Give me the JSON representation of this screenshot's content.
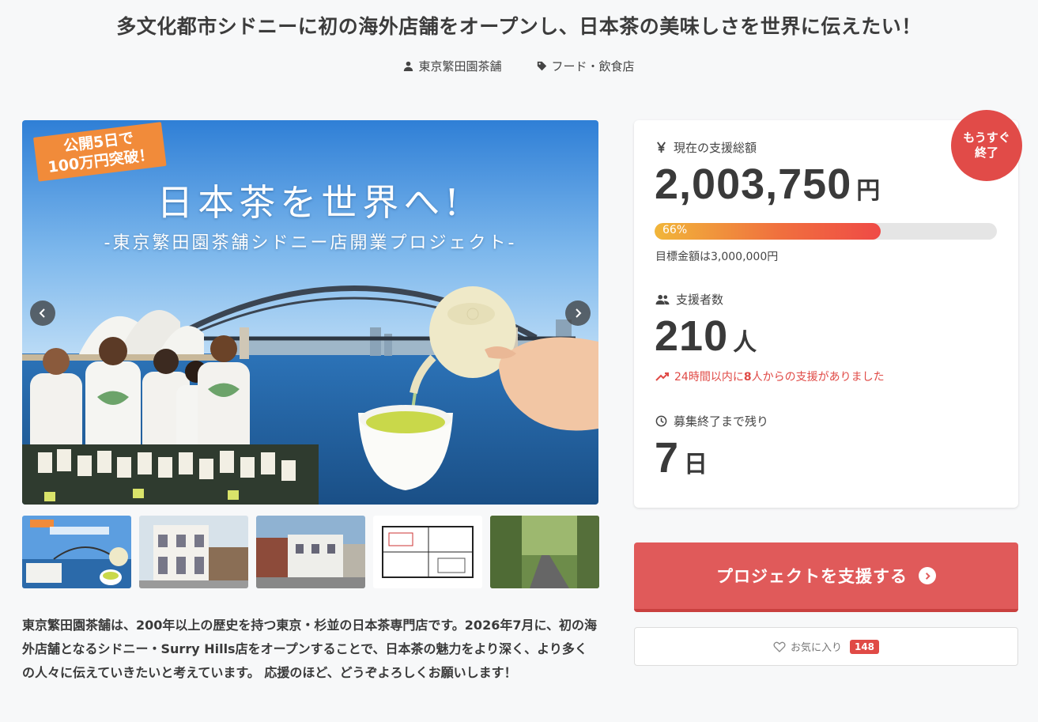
{
  "project": {
    "title": "多文化都市シドニーに初の海外店舗をオープンし、日本茶の美味しさを世界に伝えたい！",
    "owner": "東京繁田園茶舗",
    "category": "フード・飲食店"
  },
  "hero": {
    "badge_line1": "公開5日で",
    "badge_line2": "100万円突破！",
    "title": "日本茶を世界へ!",
    "subtitle": "-東京繁田園茶舗シドニー店開業プロジェクト-"
  },
  "description": "東京繁田園茶舗は、200年以上の歴史を持つ東京・杉並の日本茶専門店です。2026年7月に、初の海外店舗となるシドニー・Surry Hills店をオープンすることで、日本茶の魅力をより深く、より多くの人々に伝えていきたいと考えています。 応援のほど、どうぞよろしくお願いします！",
  "stats": {
    "total_label": "現在の支援総額",
    "total_amount": "2,003,750",
    "total_unit": "円",
    "progress_percent": 66,
    "progress_label": "66%",
    "goal_text": "目標金額は3,000,000円",
    "backers_label": "支援者数",
    "backers_count": "210",
    "backers_unit": "人",
    "recent_prefix": "24時間以内に",
    "recent_count": "8",
    "recent_suffix": "人からの支援がありました",
    "remaining_label": "募集終了まで残り",
    "remaining_days": "7",
    "remaining_unit": "日",
    "soon_badge_line1": "もうすぐ",
    "soon_badge_line2": "終了"
  },
  "actions": {
    "support_label": "プロジェクトを支援する",
    "favorite_label": "お気に入り",
    "favorite_count": "148"
  },
  "icons": {
    "owner": "user-icon",
    "category": "tag-icon",
    "total": "yen-icon",
    "backers": "users-icon",
    "recent": "trend-up-icon",
    "remaining": "clock-icon",
    "support": "chevron-circle-right-icon",
    "favorite": "heart-icon"
  },
  "colors": {
    "accent": "#e05a5a",
    "badge": "#e14b48",
    "alert_text": "#e04a46"
  }
}
